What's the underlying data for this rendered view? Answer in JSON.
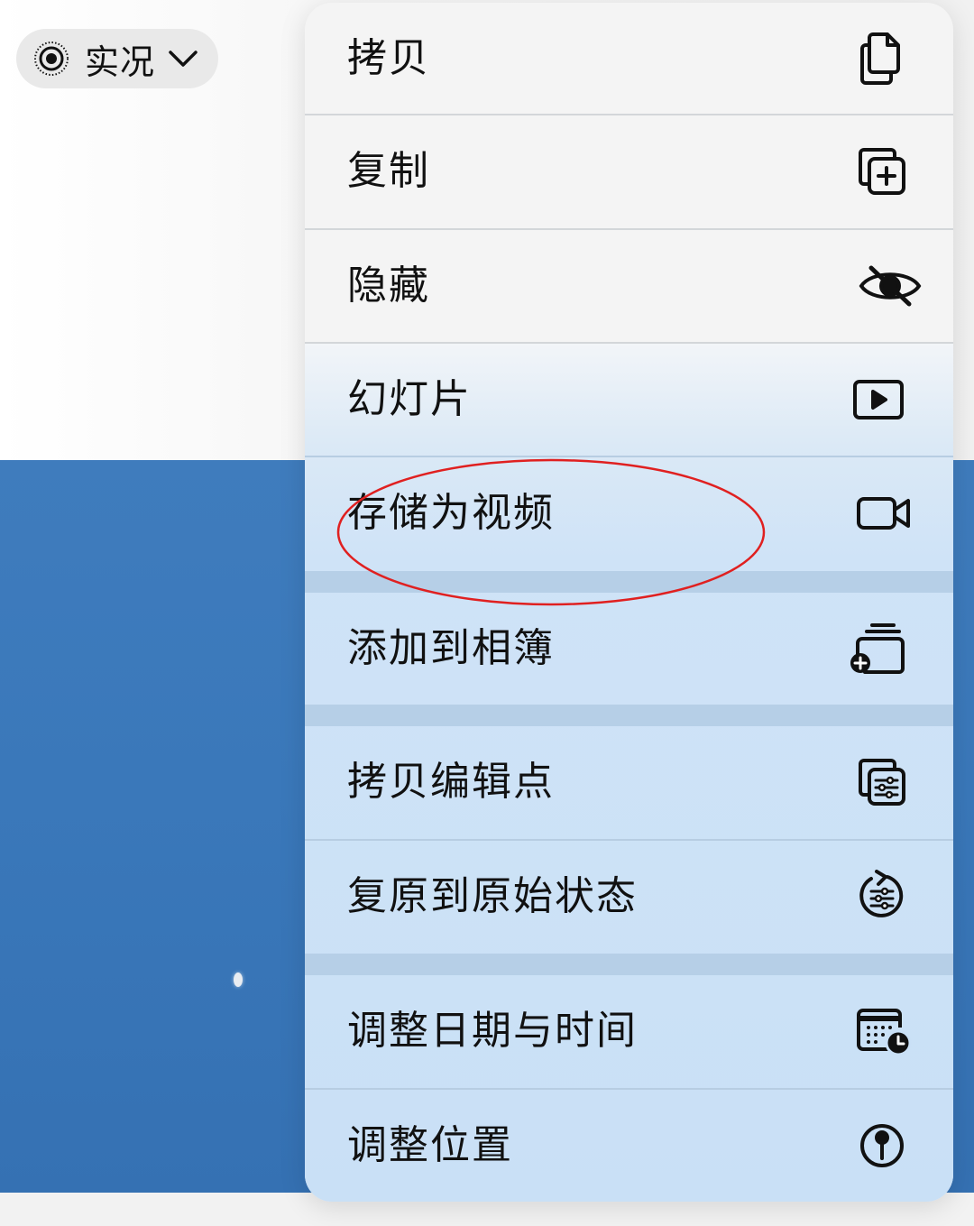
{
  "live": {
    "label": "实况",
    "icon": "live-photo-icon",
    "chevron": "chevron-down-icon"
  },
  "menu": {
    "items": [
      {
        "label": "拷贝",
        "icon": "copy-doc-icon"
      },
      {
        "label": "复制",
        "icon": "duplicate-plus-icon"
      },
      {
        "label": "隐藏",
        "icon": "eye-slash-icon"
      },
      {
        "label": "幻灯片",
        "icon": "play-rectangle-icon"
      },
      {
        "label": "存储为视频",
        "icon": "video-camera-icon"
      },
      {
        "label": "添加到相簿",
        "icon": "add-to-album-icon"
      },
      {
        "label": "拷贝编辑点",
        "icon": "copy-edits-icon"
      },
      {
        "label": "复原到原始状态",
        "icon": "revert-adjustments-icon"
      },
      {
        "label": "调整日期与时间",
        "icon": "calendar-clock-icon"
      },
      {
        "label": "调整位置",
        "icon": "location-pin-icon"
      }
    ]
  },
  "annotation": {
    "color": "#e02020",
    "target": "存储为视频"
  }
}
